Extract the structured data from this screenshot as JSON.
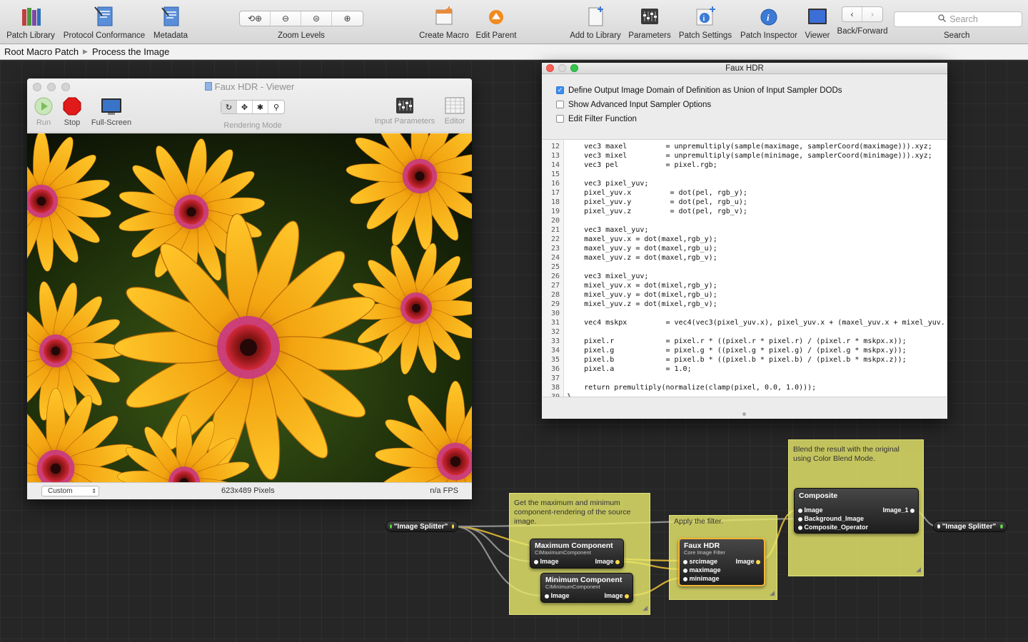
{
  "toolbar": {
    "patch_library": "Patch Library",
    "protocol_conformance": "Protocol Conformance",
    "metadata": "Metadata",
    "zoom_levels": "Zoom Levels",
    "create_macro": "Create Macro",
    "edit_parent": "Edit Parent",
    "add_to_library": "Add to Library",
    "parameters": "Parameters",
    "patch_settings": "Patch Settings",
    "patch_inspector": "Patch Inspector",
    "viewer": "Viewer",
    "back_forward": "Back/Forward",
    "search_placeholder": "Search",
    "search_label": "Search"
  },
  "breadcrumb": {
    "root": "Root Macro Patch",
    "current": "Process the Image"
  },
  "viewer": {
    "title": "Faux HDR - Viewer",
    "run": "Run",
    "stop": "Stop",
    "fullscreen": "Full-Screen",
    "rendering_mode": "Rendering Mode",
    "input_parameters": "Input Parameters",
    "editor": "Editor",
    "size_preset": "Custom",
    "dimensions": "623x489 Pixels",
    "fps": "n/a FPS"
  },
  "inspector": {
    "title": "Faux HDR",
    "options": [
      {
        "label": "Define Output Image Domain of Definition as Union of Input Sampler DODs",
        "checked": true
      },
      {
        "label": "Show Advanced Input Sampler Options",
        "checked": false
      },
      {
        "label": "Edit Filter Function",
        "checked": false
      }
    ],
    "code": [
      {
        "n": "12",
        "t": "    vec3 maxel         = unpremultiply(sample(maximage, samplerCoord(maximage))).xyz;"
      },
      {
        "n": "13",
        "t": "    vec3 mixel         = unpremultiply(sample(minimage, samplerCoord(minimage))).xyz;"
      },
      {
        "n": "14",
        "t": "    vec3 pel           = pixel.rgb;"
      },
      {
        "n": "15",
        "t": ""
      },
      {
        "n": "16",
        "t": "    vec3 pixel_yuv;"
      },
      {
        "n": "17",
        "t": "    pixel_yuv.x         = dot(pel, rgb_y);"
      },
      {
        "n": "18",
        "t": "    pixel_yuv.y         = dot(pel, rgb_u);"
      },
      {
        "n": "19",
        "t": "    pixel_yuv.z         = dot(pel, rgb_v);"
      },
      {
        "n": "20",
        "t": ""
      },
      {
        "n": "21",
        "t": "    vec3 maxel_yuv;"
      },
      {
        "n": "22",
        "t": "    maxel_yuv.x = dot(maxel,rgb_y);"
      },
      {
        "n": "23",
        "t": "    maxel_yuv.y = dot(maxel,rgb_u);"
      },
      {
        "n": "24",
        "t": "    maxel_yuv.z = dot(maxel,rgb_v);"
      },
      {
        "n": "25",
        "t": ""
      },
      {
        "n": "26",
        "t": "    vec3 mixel_yuv;"
      },
      {
        "n": "27",
        "t": "    mixel_yuv.x = dot(mixel,rgb_y);"
      },
      {
        "n": "28",
        "t": "    mixel_yuv.y = dot(mixel,rgb_u);"
      },
      {
        "n": "29",
        "t": "    mixel_yuv.z = dot(mixel,rgb_v);"
      },
      {
        "n": "30",
        "t": ""
      },
      {
        "n": "31",
        "t": "    vec4 mskpx         = vec4(vec3(pixel_yuv.x), pixel_yuv.x + (maxel_yuv.x + mixel_yuv."
      },
      {
        "n": "32",
        "t": ""
      },
      {
        "n": "33",
        "t": "    pixel.r            = pixel.r * ((pixel.r * pixel.r) / (pixel.r * mskpx.x));"
      },
      {
        "n": "34",
        "t": "    pixel.g            = pixel.g * ((pixel.g * pixel.g) / (pixel.g * mskpx.y));"
      },
      {
        "n": "35",
        "t": "    pixel.b            = pixel.b * ((pixel.b * pixel.b) / (pixel.b * mskpx.z));"
      },
      {
        "n": "36",
        "t": "    pixel.a            = 1.0;"
      },
      {
        "n": "37",
        "t": ""
      },
      {
        "n": "38",
        "t": "    return premultiply(normalize(clamp(pixel, 0.0, 1.0)));"
      },
      {
        "n": "39",
        "t": "}"
      }
    ]
  },
  "notes": {
    "get_maxmin": "Get the maximum and minimum component-rendering of the source image.",
    "apply_filter": "Apply the filter.",
    "blend": "Blend the result with the original using Color Blend Mode."
  },
  "patches": {
    "splitter_in": "\"Image Splitter\"",
    "splitter_out": "\"Image Splitter\"",
    "max_title": "Maximum Component",
    "max_sub": "CIMaximumComponent",
    "min_title": "Minimum Component",
    "min_sub": "CIMinimumComponent",
    "faux_title": "Faux HDR",
    "faux_sub": "Core Image Filter",
    "composite_title": "Composite",
    "port_image": "Image",
    "port_srcimage": "srcimage",
    "port_maximage": "maximage",
    "port_minimage": "minimage",
    "port_image1": "Image_1",
    "port_background": "Background_Image",
    "port_operator": "Composite_Operator"
  },
  "colors": {
    "accent_selection": "#f6b433",
    "note": "#e8e86c",
    "checkbox": "#3b8ef1"
  }
}
